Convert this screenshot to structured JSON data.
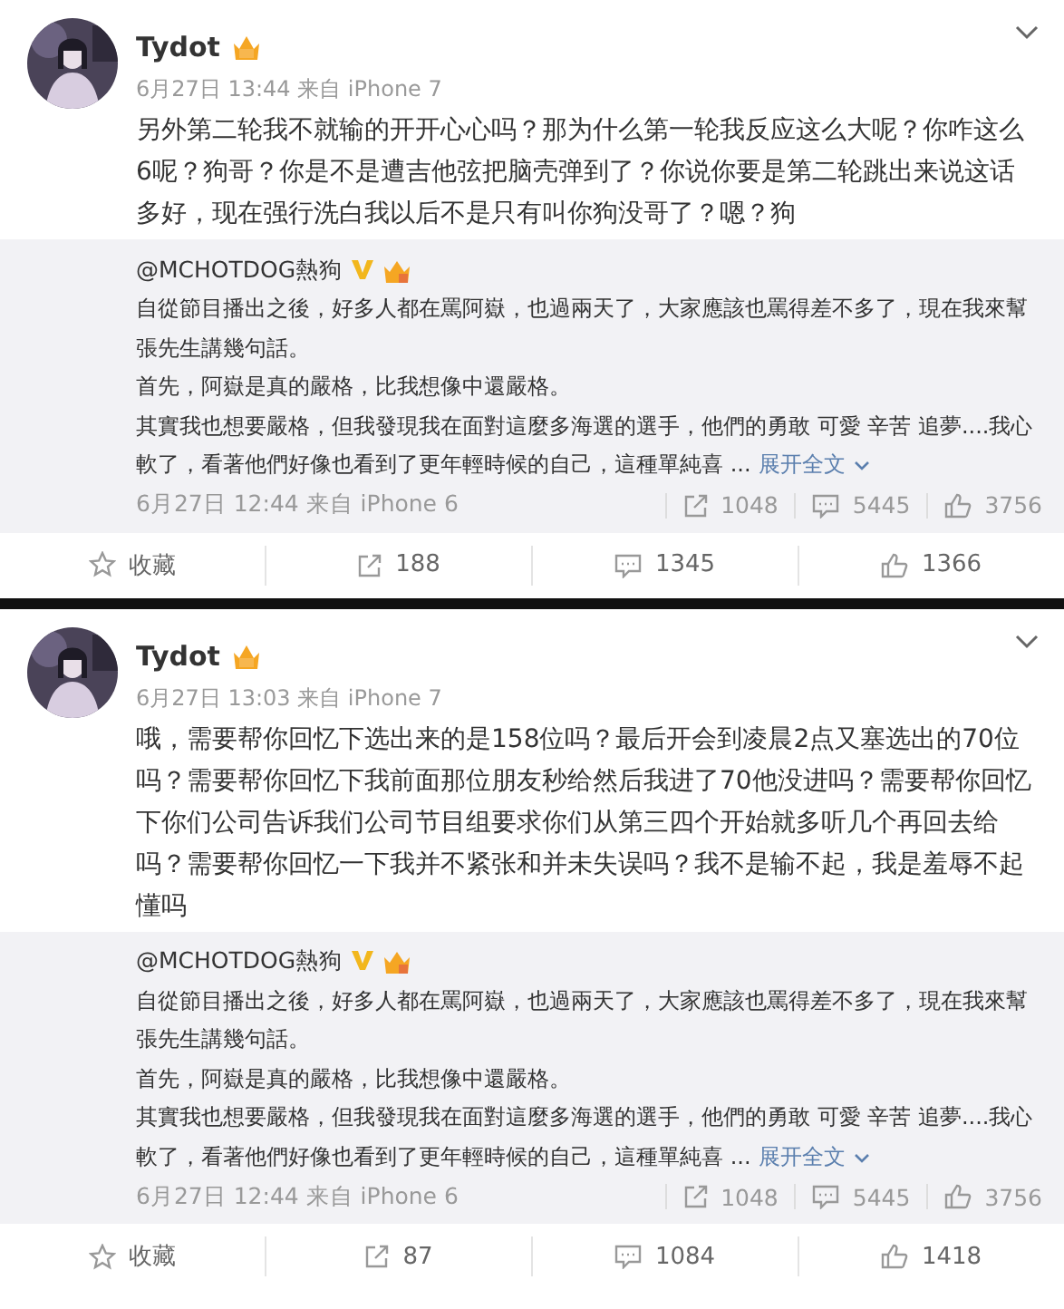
{
  "posts": [
    {
      "author": "Tydot",
      "time": "6月27日 13:44 来自 iPhone 7",
      "text": "另外第二轮我不就输的开开心心吗？那为什么第一轮我反应这么大呢？你咋这么6呢？狗哥？你是不是遭吉他弦把脑壳弹到了？你说你要是第二轮跳出来说这话多好，现在强行洗白我以后不是只有叫你狗没哥了？嗯？狗",
      "repost": {
        "author": "@MCHOTDOG熱狗",
        "verified": true,
        "paragraphs": [
          "自從節目播出之後，好多人都在罵阿嶽，也過兩天了，大家應該也罵得差不多了，現在我來幫張先生講幾句話。",
          "首先，阿嶽是真的嚴格，比我想像中還嚴格。",
          "其實我也想要嚴格，但我發現我在面對這麼多海選的選手，他們的勇敢 可愛 辛苦 追夢....我心軟了，看著他們好像也看到了更年輕時候的自己，這種單純喜 ..."
        ],
        "more_link": "展开全文",
        "time": "6月27日 12:44 来自 iPhone 6",
        "stats": [
          {
            "kind": "repost",
            "count": "1048"
          },
          {
            "kind": "comment",
            "count": "5445"
          },
          {
            "kind": "like",
            "count": "3756"
          }
        ]
      },
      "actions": [
        {
          "kind": "favorite",
          "label": "收藏"
        },
        {
          "kind": "repost",
          "label": "188"
        },
        {
          "kind": "comment",
          "label": "1345"
        },
        {
          "kind": "like",
          "label": "1366"
        }
      ]
    },
    {
      "author": "Tydot",
      "time": "6月27日 13:03 来自 iPhone 7",
      "text": "哦，需要帮你回忆下选出来的是158位吗？最后开会到凌晨2点又塞选出的70位吗？需要帮你回忆下我前面那位朋友秒给然后我进了70他没进吗？需要帮你回忆下你们公司告诉我们公司节目组要求你们从第三四个开始就多听几个再回去给吗？需要帮你回忆一下我并不紧张和并未失误吗？我不是输不起，我是羞辱不起懂吗",
      "repost": {
        "author": "@MCHOTDOG熱狗",
        "verified": true,
        "paragraphs": [
          "自從節目播出之後，好多人都在罵阿嶽，也過兩天了，大家應該也罵得差不多了，現在我來幫張先生講幾句話。",
          "首先，阿嶽是真的嚴格，比我想像中還嚴格。",
          "其實我也想要嚴格，但我發現我在面對這麼多海選的選手，他們的勇敢 可愛 辛苦 追夢....我心軟了，看著他們好像也看到了更年輕時候的自己，這種單純喜 ..."
        ],
        "more_link": "展开全文",
        "time": "6月27日 12:44 来自 iPhone 6",
        "stats": [
          {
            "kind": "repost",
            "count": "1048"
          },
          {
            "kind": "comment",
            "count": "5445"
          },
          {
            "kind": "like",
            "count": "3756"
          }
        ]
      },
      "actions": [
        {
          "kind": "favorite",
          "label": "收藏"
        },
        {
          "kind": "repost",
          "label": "87"
        },
        {
          "kind": "comment",
          "label": "1084"
        },
        {
          "kind": "like",
          "label": "1418"
        }
      ]
    }
  ]
}
